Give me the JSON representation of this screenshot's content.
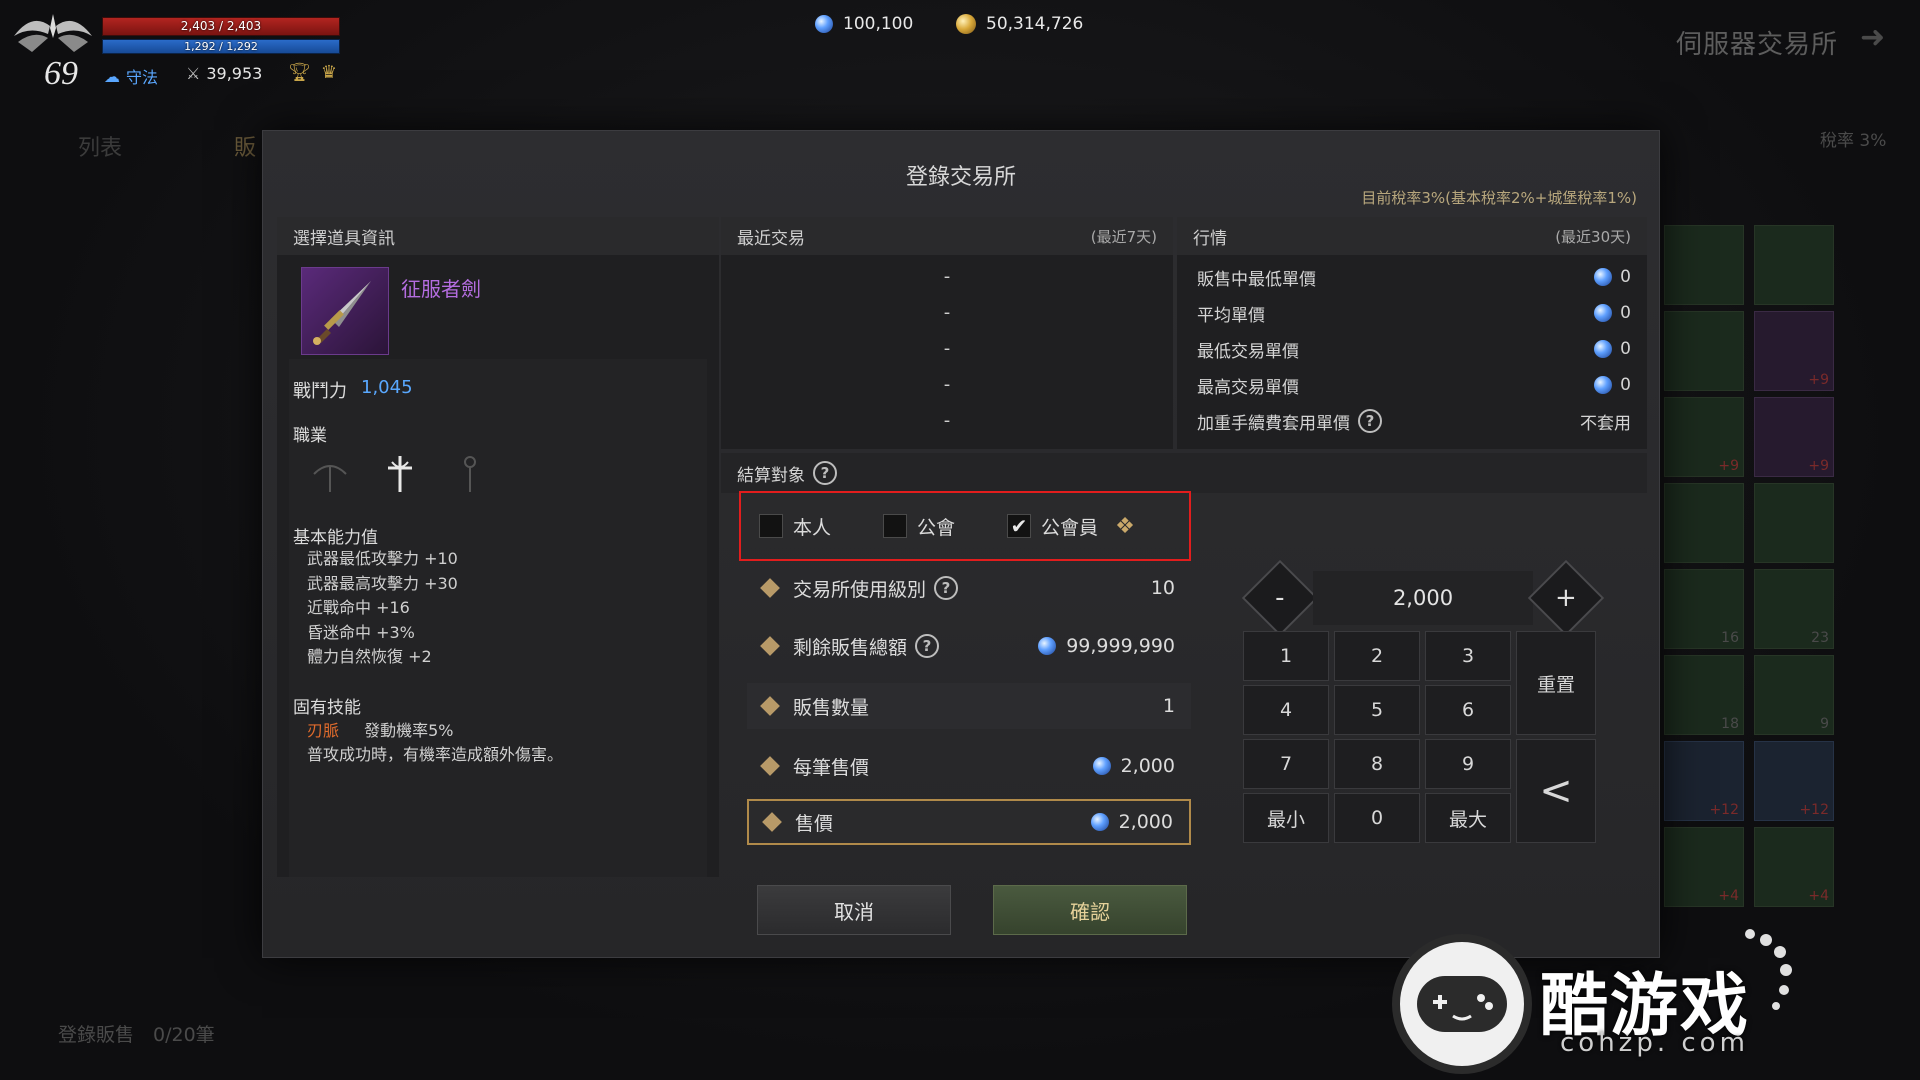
{
  "hud": {
    "hp": "2,403 / 2,403",
    "mp": "1,292 / 1,292",
    "level": "69",
    "alignment": "守法",
    "combat_power": "39,953",
    "diamonds": "100,100",
    "gold": "50,314,726",
    "server_title": "伺服器交易所",
    "tab_list": "列表",
    "tab_sell": "販",
    "tax_rate": "稅率 3%",
    "register_count": "登錄販售　0/20筆",
    "hp_fill": 1.0,
    "mp_fill": 1.0
  },
  "modal": {
    "title": "登錄交易所",
    "tax_note": "目前稅率3%(基本稅率2%+城堡稅率1%)",
    "item_info": {
      "header": "選擇道具資訊",
      "item_name": "征服者劍",
      "combat_label": "戰鬥力",
      "combat_value": "1,045",
      "class_label": "職業",
      "base_label": "基本能力值",
      "stats": [
        "武器最低攻擊力 +10",
        "武器最高攻擊力 +30",
        "近戰命中 +16",
        "昏迷命中 +3%",
        "體力自然恢復 +2"
      ],
      "skill_label": "固有技能",
      "skill_name": "刃脈",
      "skill_rate": "發動機率5%",
      "skill_desc": "普攻成功時，有機率造成額外傷害。"
    },
    "recent": {
      "header": "最近交易",
      "period": "(最近7天)",
      "rows": [
        "-",
        "-",
        "-",
        "-",
        "-"
      ]
    },
    "market": {
      "header": "行情",
      "period": "(最近30天)",
      "rows": [
        {
          "label": "販售中最低單價",
          "value": "0"
        },
        {
          "label": "平均單價",
          "value": "0"
        },
        {
          "label": "最低交易單價",
          "value": "0"
        },
        {
          "label": "最高交易單價",
          "value": "0"
        }
      ],
      "fee_label": "加重手續費套用單價",
      "fee_value": "不套用"
    },
    "settlement": {
      "label": "結算對象",
      "options": [
        {
          "label": "本人",
          "checked": false
        },
        {
          "label": "公會",
          "checked": false
        },
        {
          "label": "公會員",
          "checked": true
        }
      ]
    },
    "form": {
      "level_label": "交易所使用級別",
      "level_value": "10",
      "remain_label": "剩餘販售總額",
      "remain_value": "99,999,990",
      "qty_label": "販售數量",
      "qty_value": "1",
      "unit_label": "每筆售價",
      "unit_value": "2,000",
      "price_label": "售價",
      "price_value": "2,000"
    },
    "keypad": {
      "value": "2,000",
      "minus": "-",
      "plus": "+",
      "keys": [
        "1",
        "2",
        "3",
        "4",
        "5",
        "6",
        "7",
        "8",
        "9",
        "最小",
        "0",
        "最大"
      ],
      "reset": "重置",
      "back": "<"
    },
    "cancel": "取消",
    "confirm": "確認"
  },
  "inventory": {
    "badges": [
      "",
      "",
      "",
      "+9",
      "+9",
      "+9",
      "",
      "",
      "16",
      "23",
      "18",
      "9",
      "+12",
      "+12",
      "+4",
      "+4"
    ]
  },
  "watermark": {
    "text": "酷游戏",
    "sub": "cohzp. com"
  },
  "colors": {
    "accent_red": "#e21d1d",
    "item_purple": "#b46de0",
    "combat_blue": "#59a8ff",
    "skill_orange": "#e06b2c"
  }
}
